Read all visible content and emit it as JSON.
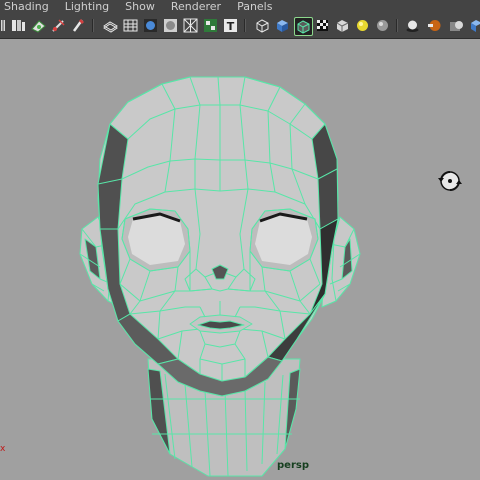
{
  "menubar": {
    "items": [
      {
        "label": "Shading"
      },
      {
        "label": "Lighting"
      },
      {
        "label": "Show"
      },
      {
        "label": "Renderer"
      },
      {
        "label": "Panels"
      }
    ]
  },
  "toolbar": {
    "icons": [
      "grip-icon",
      "camera-attributes-icon",
      "select-camera-icon",
      "bookmark-icon",
      "image-plane-icon",
      "wireframe-icon",
      "grid-icon",
      "smooth-shade-icon",
      "flat-shade-icon",
      "xray-icon",
      "textured-icon",
      "text-icon",
      "bounding-box-icon",
      "solid-cube-icon",
      "wireframe-on-shaded-icon",
      "checker-icon",
      "default-light-icon",
      "all-lights-icon",
      "shadows-icon",
      "ambient-occlusion-icon",
      "motion-blur-icon"
    ],
    "active_icon": "wireframe-on-shaded-icon"
  },
  "viewport": {
    "camera_label": "persp",
    "axis_marker": "x",
    "wire_color": "#58e6a8",
    "shade_light": "#d6d6d6",
    "shade_dark": "#4a4a4a",
    "background": "#a0a0a0"
  }
}
